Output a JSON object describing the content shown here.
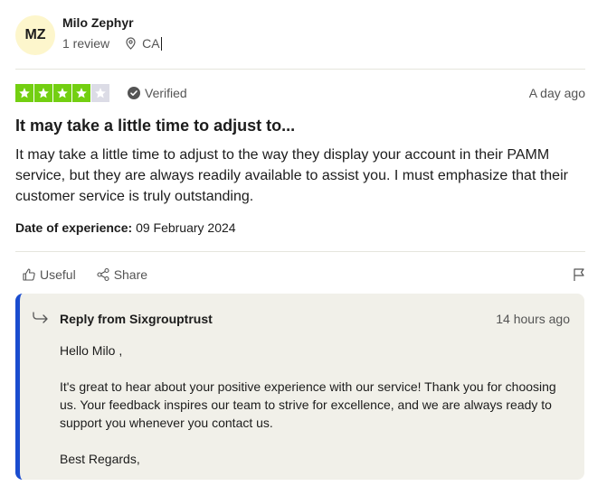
{
  "reviewer": {
    "initials": "MZ",
    "name": "Milo Zephyr",
    "review_count": "1 review",
    "location": "CA"
  },
  "review": {
    "rating": 4,
    "max_rating": 5,
    "verified_label": "Verified",
    "date_ago": "A day ago",
    "title": "It may take a little time to adjust to...",
    "body": "It may take a little time to adjust to the way they display your account in their PAMM service, but they are always readily available to assist you. I must emphasize that their customer service is truly outstanding.",
    "experience_label": "Date of experience:",
    "experience_date": "09 February 2024"
  },
  "actions": {
    "useful_label": "Useful",
    "share_label": "Share"
  },
  "reply": {
    "from": "Reply from Sixgrouptrust",
    "date_ago": "14 hours ago",
    "greeting": "Hello Milo ,",
    "message": "It's great to hear about your positive experience with our service! Thank you for choosing us. Your feedback inspires our team to strive for excellence, and we are always ready to support you whenever you contact us.",
    "signoff": "Best Regards,"
  },
  "colors": {
    "star_filled": "#73cf11",
    "star_empty": "#dcdce6",
    "reply_accent": "#1a4ccf",
    "reply_bg": "#f1f0e9"
  },
  "icons": {
    "location": "location-pin-icon",
    "verified": "check-circle-icon",
    "useful": "thumbs-up-icon",
    "share": "share-icon",
    "flag": "flag-icon",
    "reply": "reply-arrow-icon"
  }
}
